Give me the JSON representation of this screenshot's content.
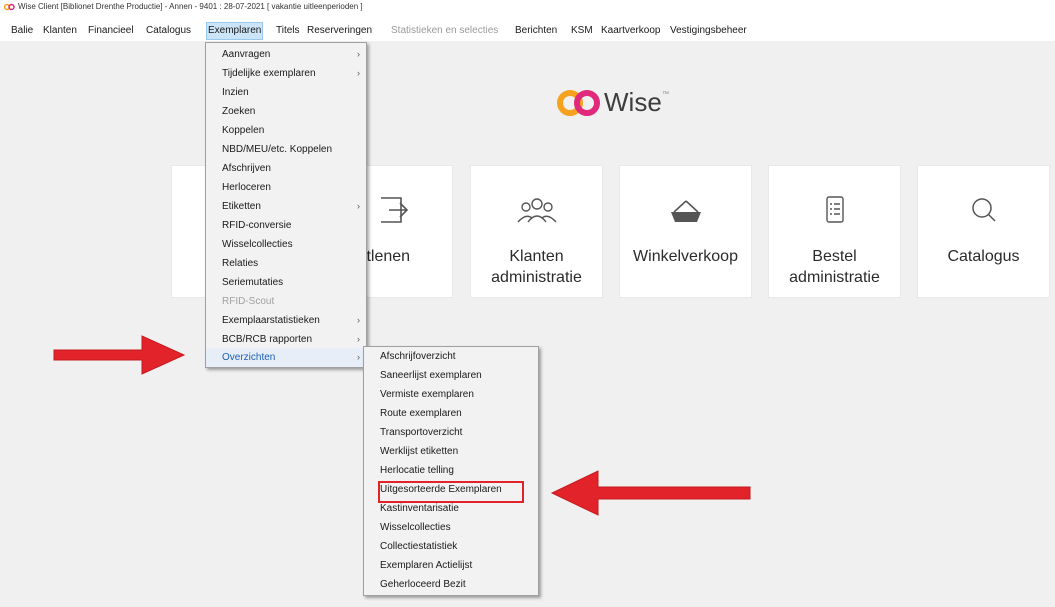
{
  "window": {
    "title": "Wise Client [Biblionet Drenthe Productie] - Annen - 9401 : 28-07-2021 [ vakantie uitleenperioden ]"
  },
  "menubar": {
    "items": [
      {
        "label": "Balie"
      },
      {
        "label": "Klanten"
      },
      {
        "label": "Financieel"
      },
      {
        "label": "Catalogus"
      },
      {
        "label": "Exemplaren",
        "active": true
      },
      {
        "label": "Titels"
      },
      {
        "label": "Reserveringen"
      },
      {
        "label": "Statistieken en selecties",
        "disabled": true
      },
      {
        "label": "Berichten"
      },
      {
        "label": "KSM"
      },
      {
        "label": "Kaartverkoop"
      },
      {
        "label": "Vestigingsbeheer"
      }
    ]
  },
  "brand": {
    "name": "Wise",
    "mark": "™",
    "colors": {
      "left": "#f6a21e",
      "right": "#e0297a"
    }
  },
  "tiles": [
    {
      "label": "",
      "icon": "hidden-tile"
    },
    {
      "label": "itlenen",
      "icon": "arrow-out-icon"
    },
    {
      "label": "Klanten\nadministratie",
      "icon": "people-icon"
    },
    {
      "label": "Winkelverkoop",
      "icon": "basket-icon"
    },
    {
      "label": "Bestel\nadministratie",
      "icon": "list-icon"
    },
    {
      "label": "Catalogus",
      "icon": "search-icon"
    }
  ],
  "exemplaren_menu": {
    "items": [
      {
        "label": "Aanvragen",
        "sub": true
      },
      {
        "label": "Tijdelijke exemplaren",
        "sub": true
      },
      {
        "label": "Inzien"
      },
      {
        "label": "Zoeken"
      },
      {
        "label": "Koppelen"
      },
      {
        "label": "NBD/MEU/etc. Koppelen"
      },
      {
        "label": "Afschrijven"
      },
      {
        "label": "Herloceren"
      },
      {
        "label": "Etiketten",
        "sub": true
      },
      {
        "label": "RFID-conversie"
      },
      {
        "label": "Wisselcollecties"
      },
      {
        "label": "Relaties"
      },
      {
        "label": "Seriemutaties"
      },
      {
        "label": "RFID-Scout",
        "disabled": true
      },
      {
        "label": "Exemplaarstatistieken",
        "sub": true
      },
      {
        "label": "BCB/RCB rapporten",
        "sub": true
      },
      {
        "label": "Overzichten",
        "sub": true,
        "hot": true
      }
    ],
    "submenu_glyph": "›"
  },
  "overzichten_menu": {
    "items": [
      {
        "label": "Afschrijfoverzicht"
      },
      {
        "label": "Saneerlijst exemplaren"
      },
      {
        "label": "Vermiste exemplaren"
      },
      {
        "label": "Route exemplaren"
      },
      {
        "label": "Transportoverzicht"
      },
      {
        "label": "Werklijst etiketten"
      },
      {
        "label": "Herlocatie telling"
      },
      {
        "label": "Uitgesorteerde Exemplaren",
        "highlighted": true
      },
      {
        "label": "Kastinventarisatie"
      },
      {
        "label": "Wisselcollecties"
      },
      {
        "label": "Collectiestatistiek"
      },
      {
        "label": "Exemplaren Actielijst"
      },
      {
        "label": "Geherloceerd Bezit"
      }
    ]
  },
  "annotation": {
    "arrow_color": "#e2232a"
  }
}
